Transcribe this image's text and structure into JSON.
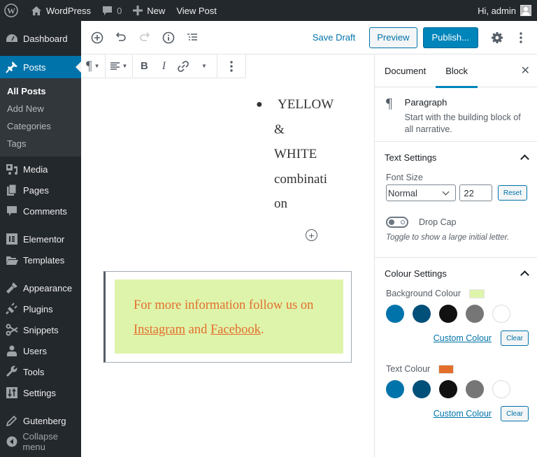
{
  "adminbar": {
    "site_name": "WordPress",
    "comments_count": "0",
    "new_label": "New",
    "view_post_label": "View Post",
    "greeting": "Hi, admin"
  },
  "sidebar": {
    "items": [
      {
        "label": "Dashboard",
        "icon": "dashboard-icon"
      },
      {
        "label": "Posts",
        "icon": "pin-icon",
        "active": true
      },
      {
        "label": "Media",
        "icon": "media-icon"
      },
      {
        "label": "Pages",
        "icon": "pages-icon"
      },
      {
        "label": "Comments",
        "icon": "comments-icon"
      },
      {
        "label": "Elementor",
        "icon": "elementor-icon"
      },
      {
        "label": "Templates",
        "icon": "folder-icon"
      },
      {
        "label": "Appearance",
        "icon": "brush-icon"
      },
      {
        "label": "Plugins",
        "icon": "plug-icon"
      },
      {
        "label": "Snippets",
        "icon": "scissors-icon"
      },
      {
        "label": "Users",
        "icon": "user-icon"
      },
      {
        "label": "Tools",
        "icon": "wrench-icon"
      },
      {
        "label": "Settings",
        "icon": "settings-icon"
      },
      {
        "label": "Gutenberg",
        "icon": "pencil-icon"
      },
      {
        "label": "Collapse menu",
        "icon": "collapse-icon"
      }
    ],
    "submenu": [
      "All Posts",
      "Add New",
      "Categories",
      "Tags"
    ]
  },
  "header": {
    "save_draft": "Save Draft",
    "preview": "Preview",
    "publish": "Publish..."
  },
  "content": {
    "list_lines": [
      "YELLOW",
      "&",
      "WHITE",
      "combinati",
      "on"
    ],
    "callout": {
      "line1": "For more information follow us on",
      "link1": "Instagram",
      "and": " and ",
      "link2": "Facebook",
      "end": "."
    }
  },
  "settings": {
    "tabs": [
      "Document",
      "Block"
    ],
    "active_tab": "Block",
    "block_card": {
      "title": "Paragraph",
      "description": "Start with the building block of all narrative."
    },
    "text_settings": {
      "title": "Text Settings",
      "font_size_label": "Font Size",
      "font_size_select": "Normal",
      "font_size_value": "22",
      "reset_label": "Reset",
      "drop_cap_label": "Drop Cap",
      "drop_cap_enabled": false,
      "drop_cap_help": "Toggle to show a large initial letter."
    },
    "colour_settings": {
      "title": "Colour Settings",
      "background_label": "Background Colour",
      "background_value": "#dff4ab",
      "text_label": "Text Colour",
      "text_value": "#e26f2c",
      "palette": [
        "#0073aa",
        "#00507a",
        "#111111",
        "#767676",
        "#ffffff"
      ],
      "custom_label": "Custom Colour",
      "clear_label": "Clear"
    }
  }
}
